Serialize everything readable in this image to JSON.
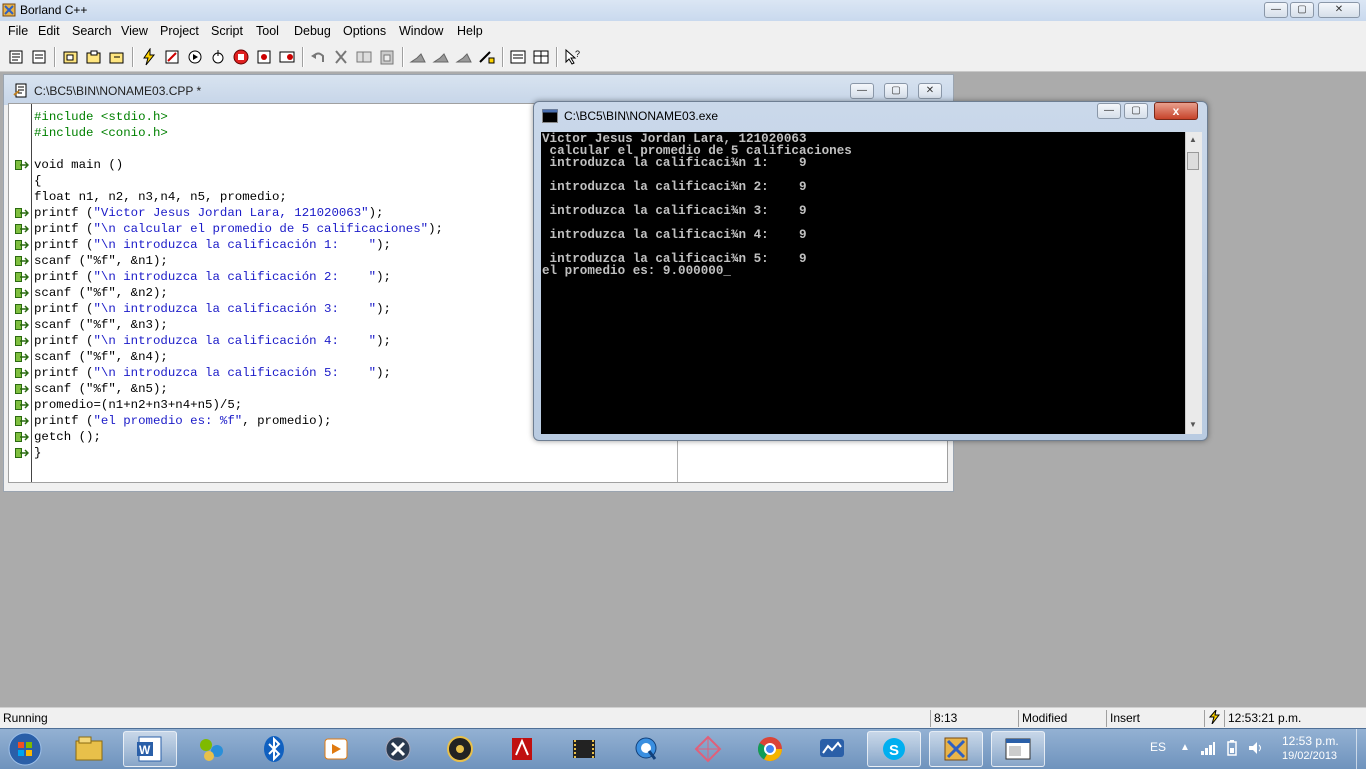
{
  "app": {
    "title": "Borland C++"
  },
  "menu": [
    "File",
    "Edit",
    "Search",
    "View",
    "Project",
    "Script",
    "Tool",
    "Debug",
    "Options",
    "Window",
    "Help"
  ],
  "editor": {
    "title": "C:\\BC5\\BIN\\NONAME03.CPP *",
    "lines": [
      {
        "text": "#include <stdio.h>",
        "cls": "dir",
        "mark": false
      },
      {
        "text": "#include <conio.h>",
        "cls": "dir",
        "mark": false
      },
      {
        "text": "",
        "cls": "",
        "mark": false
      },
      {
        "text": "void main ()",
        "cls": "",
        "mark": true
      },
      {
        "text": "{",
        "cls": "",
        "mark": false
      },
      {
        "text": "float n1, n2, n3,n4, n5, promedio;",
        "cls": "",
        "mark": false
      },
      {
        "pre": "printf (",
        "str": "\"Victor Jesus Jordan Lara, 121020063\"",
        "post": ");",
        "mark": true
      },
      {
        "pre": "printf (",
        "str": "\"\\n calcular el promedio de 5 calificaciones\"",
        "post": ");",
        "mark": true
      },
      {
        "pre": "printf (",
        "str": "\"\\n introduzca la calificación 1:    \"",
        "post": ");",
        "mark": true
      },
      {
        "text": "scanf (\"%f\", &n1);",
        "cls": "",
        "mark": true
      },
      {
        "pre": "printf (",
        "str": "\"\\n introduzca la calificación 2:    \"",
        "post": ");",
        "mark": true
      },
      {
        "text": "scanf (\"%f\", &n2);",
        "cls": "",
        "mark": true
      },
      {
        "pre": "printf (",
        "str": "\"\\n introduzca la calificación 3:    \"",
        "post": ");",
        "mark": true
      },
      {
        "text": "scanf (\"%f\", &n3);",
        "cls": "",
        "mark": true
      },
      {
        "pre": "printf (",
        "str": "\"\\n introduzca la calificación 4:    \"",
        "post": ");",
        "mark": true
      },
      {
        "text": "scanf (\"%f\", &n4);",
        "cls": "",
        "mark": true
      },
      {
        "pre": "printf (",
        "str": "\"\\n introduzca la calificación 5:    \"",
        "post": ");",
        "mark": true
      },
      {
        "text": "scanf (\"%f\", &n5);",
        "cls": "",
        "mark": true
      },
      {
        "text": "promedio=(n1+n2+n3+n4+n5)/5;",
        "cls": "",
        "mark": true
      },
      {
        "pre": "printf (",
        "str": "\"el promedio es: %f\"",
        "post": ", promedio);",
        "mark": true
      },
      {
        "text": "getch ();",
        "cls": "",
        "mark": true
      },
      {
        "text": "}",
        "cls": "",
        "mark": true
      }
    ]
  },
  "console": {
    "title": "C:\\BC5\\BIN\\NONAME03.exe",
    "close_label": "x",
    "output": "Victor Jesus Jordan Lara, 121020063\n calcular el promedio de 5 calificaciones\n introduzca la calificaci¾n 1:    9\n\n introduzca la calificaci¾n 2:    9\n\n introduzca la calificaci¾n 3:    9\n\n introduzca la calificaci¾n 4:    9\n\n introduzca la calificaci¾n 5:    9\nel promedio es: 9.000000_"
  },
  "status": {
    "state": "Running",
    "position": "8:13",
    "modified": "Modified",
    "mode": "Insert",
    "time": "12:53:21 p.m."
  },
  "taskbar": {
    "apps": [
      "explorer-icon",
      "word-icon",
      "network-icon",
      "bluetooth-icon",
      "media-player-icon",
      "app-x-icon",
      "cd-burner-icon",
      "acrobat-icon",
      "film-icon",
      "quicktime-icon",
      "zune-icon",
      "chrome-icon",
      "messenger-icon",
      "skype-icon",
      "borland-icon",
      "console-app-icon"
    ],
    "language": "ES",
    "clock_time": "12:53 p.m.",
    "clock_date": "19/02/2013"
  }
}
